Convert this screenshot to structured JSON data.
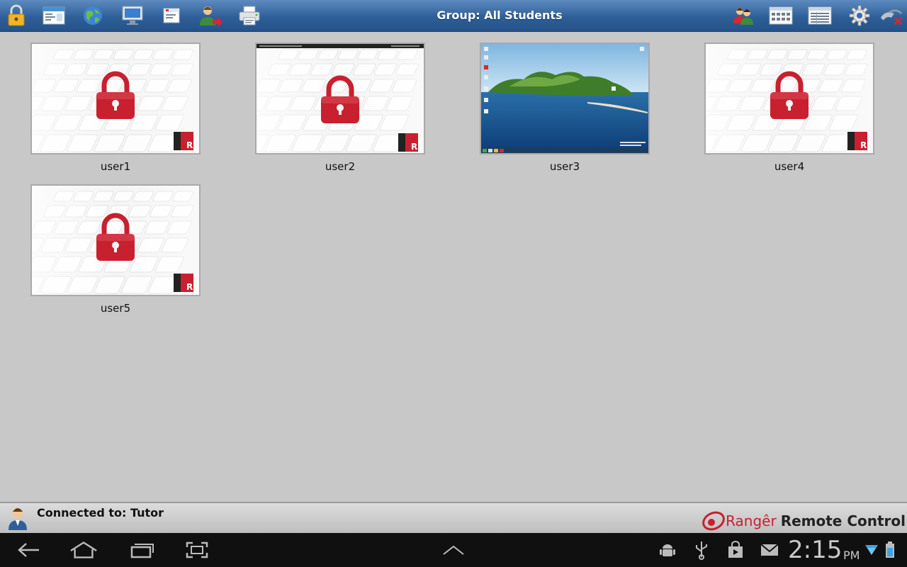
{
  "toolbar": {
    "title": "Group: All Students",
    "left_icons": [
      "lock-icon",
      "window-icon",
      "globe-icon",
      "monitor-icon",
      "app-window-icon",
      "user-arrow-icon",
      "printer-icon"
    ],
    "right_icons": [
      "students-icon",
      "grid-view-icon",
      "list-view-icon",
      "gear-icon",
      "disconnect-icon"
    ]
  },
  "students": [
    {
      "name": "user1",
      "state": "locked"
    },
    {
      "name": "user2",
      "state": "locked"
    },
    {
      "name": "user3",
      "state": "desktop"
    },
    {
      "name": "user4",
      "state": "locked"
    },
    {
      "name": "user5",
      "state": "locked"
    }
  ],
  "status": {
    "connected_label": "Connected to: Tutor",
    "brand_name": "Rangêr",
    "brand_suffix": "Remote Control"
  },
  "system_bar": {
    "time": "2:15",
    "ampm": "PM"
  },
  "colors": {
    "toolbar": "#2f5f98",
    "background": "#c8c8c8",
    "lock_red": "#c8202f"
  }
}
